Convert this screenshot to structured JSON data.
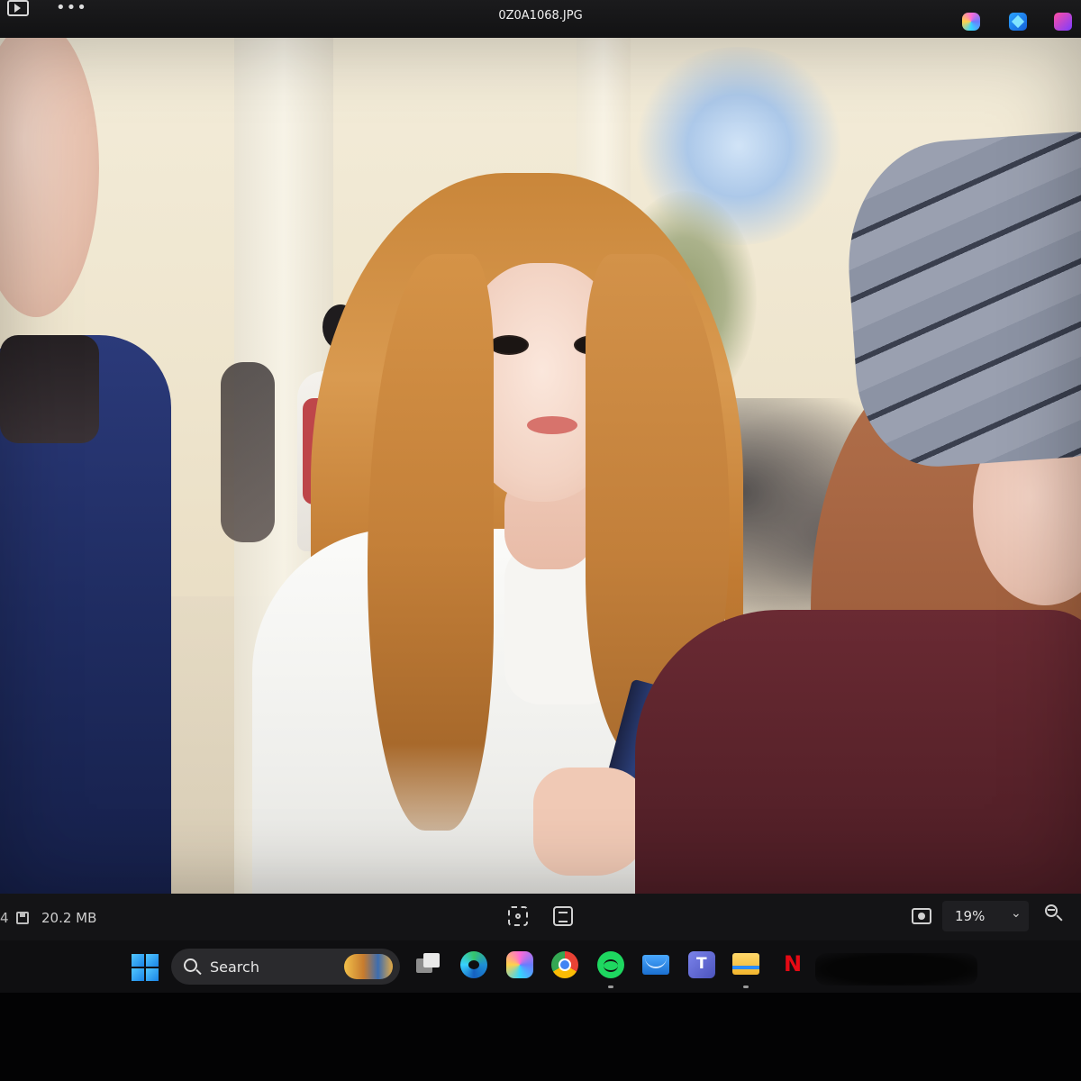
{
  "window": {
    "title": "0Z0A1068.JPG",
    "more_label": "•••"
  },
  "photo": {
    "alt": "Photo: woman with long wavy blonde hair in white jacket holding a phone, crowd in background"
  },
  "status": {
    "left_stub": "4",
    "file_size": "20.2 MB",
    "zoom_value": "19%",
    "zoom_chevron": "⌄"
  },
  "taskbar": {
    "search_label": "Search",
    "apps": [
      "task-view",
      "edge",
      "copilot",
      "chrome",
      "spotify",
      "mail",
      "teams",
      "file-explorer",
      "netflix"
    ]
  }
}
